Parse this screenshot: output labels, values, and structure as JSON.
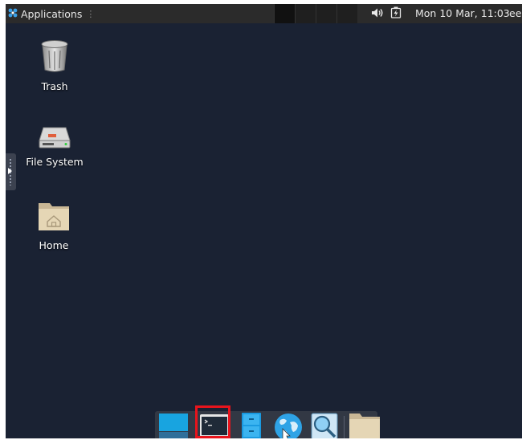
{
  "top_panel": {
    "applications_label": "Applications",
    "applications_icon": "xfce-menu-icon",
    "volume_icon": "volume-icon",
    "battery_icon": "battery-charging-icon",
    "clock": "Mon 10 Mar, 11:03",
    "user": "ee"
  },
  "desktop": {
    "background_color": "#1a2233",
    "icons": [
      {
        "label": "Trash",
        "icon": "trash-icon"
      },
      {
        "label": "File System",
        "icon": "drive-icon"
      },
      {
        "label": "Home",
        "icon": "home-folder-icon"
      }
    ]
  },
  "dock": {
    "items": [
      {
        "name": "show-desktop",
        "icon": "show-desktop-icon"
      },
      {
        "name": "terminal",
        "icon": "terminal-icon",
        "highlighted": true
      },
      {
        "name": "file-manager",
        "icon": "file-cabinet-icon"
      },
      {
        "name": "web-browser",
        "icon": "globe-icon"
      },
      {
        "name": "app-finder",
        "icon": "magnifier-icon"
      },
      {
        "name": "home-folder",
        "icon": "folder-icon"
      }
    ],
    "highlight_color": "#e8141c"
  }
}
